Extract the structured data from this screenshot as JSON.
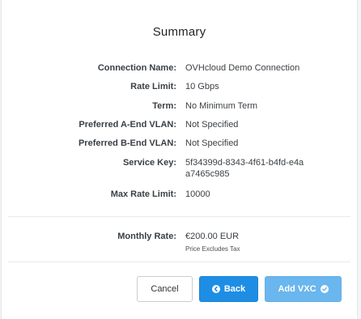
{
  "title": "Summary",
  "fields": [
    {
      "label": "Connection Name:",
      "value": "OVHcloud Demo Connection"
    },
    {
      "label": "Rate Limit:",
      "value": "10 Gbps"
    },
    {
      "label": "Term:",
      "value": "No Minimum Term"
    },
    {
      "label": "Preferred A-End VLAN:",
      "value": "Not Specified"
    },
    {
      "label": "Preferred B-End VLAN:",
      "value": "Not Specified"
    },
    {
      "label": "Service Key:",
      "value": "5f34399d-8343-4f61-b4fd-e4aa7465c985"
    },
    {
      "label": "Max Rate Limit:",
      "value": "10000"
    }
  ],
  "pricing": {
    "label": "Monthly Rate:",
    "value": "€200.00 EUR",
    "note": "Price Excludes Tax"
  },
  "buttons": {
    "cancel": "Cancel",
    "back": "Back",
    "add": "Add VXC"
  },
  "icons": {
    "back": "chevron-left-circle-icon",
    "add": "check-circle-icon"
  },
  "colors": {
    "back_button": "#1e8ee4",
    "add_button": "#6ab6ee"
  }
}
